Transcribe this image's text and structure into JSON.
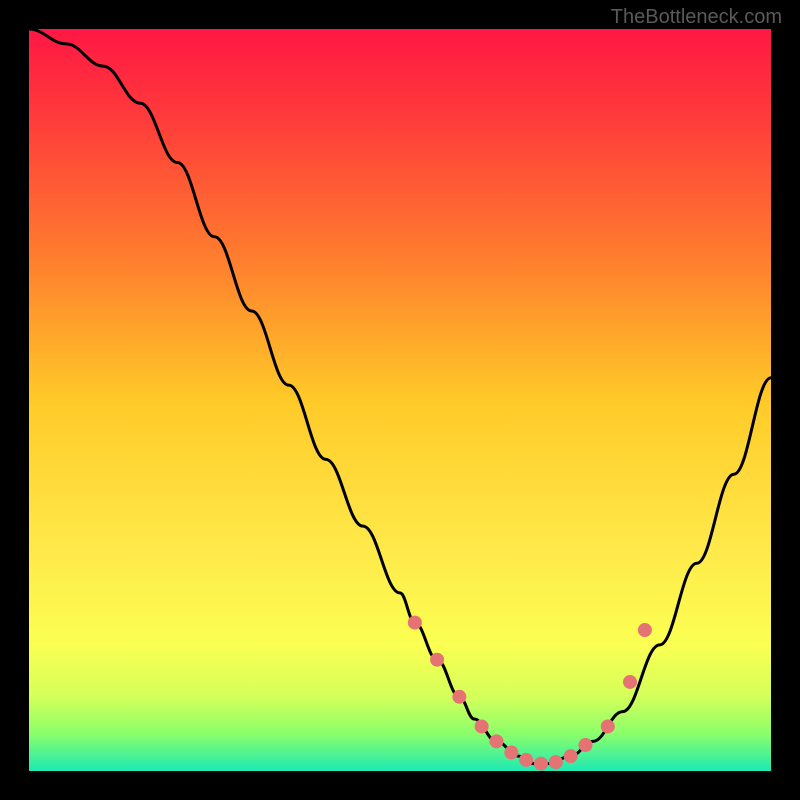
{
  "watermark": "TheBottleneck.com",
  "chart_data": {
    "type": "line",
    "title": "",
    "xlabel": "",
    "ylabel": "",
    "xlim": [
      0,
      100
    ],
    "ylim": [
      0,
      100
    ],
    "series": [
      {
        "name": "bottleneck-curve",
        "x": [
          0,
          5,
          10,
          15,
          20,
          25,
          30,
          35,
          40,
          45,
          50,
          52,
          55,
          58,
          60,
          63,
          66,
          68,
          70,
          73,
          76,
          80,
          85,
          90,
          95,
          100
        ],
        "y": [
          100,
          98,
          95,
          90,
          82,
          72,
          62,
          52,
          42,
          33,
          24,
          20,
          15,
          10,
          7,
          4,
          2,
          1,
          1,
          2,
          4,
          8,
          17,
          28,
          40,
          53
        ]
      }
    ],
    "markers": {
      "name": "data-points",
      "x": [
        52,
        55,
        58,
        61,
        63,
        65,
        67,
        69,
        71,
        73,
        75,
        78,
        81,
        83
      ],
      "y": [
        20,
        15,
        10,
        6,
        4,
        2.5,
        1.5,
        1,
        1.2,
        2,
        3.5,
        6,
        12,
        19
      ]
    },
    "gradient_stops": [
      {
        "offset": 0.0,
        "color": "#ff1744"
      },
      {
        "offset": 0.12,
        "color": "#ff3b3b"
      },
      {
        "offset": 0.3,
        "color": "#ff7a2e"
      },
      {
        "offset": 0.5,
        "color": "#ffca28"
      },
      {
        "offset": 0.7,
        "color": "#ffe94a"
      },
      {
        "offset": 0.83,
        "color": "#fbff52"
      },
      {
        "offset": 0.9,
        "color": "#d4ff5a"
      },
      {
        "offset": 0.95,
        "color": "#8aff6a"
      },
      {
        "offset": 1.0,
        "color": "#1de9b6"
      }
    ],
    "marker_color": "#e57373",
    "curve_color": "#000000"
  }
}
